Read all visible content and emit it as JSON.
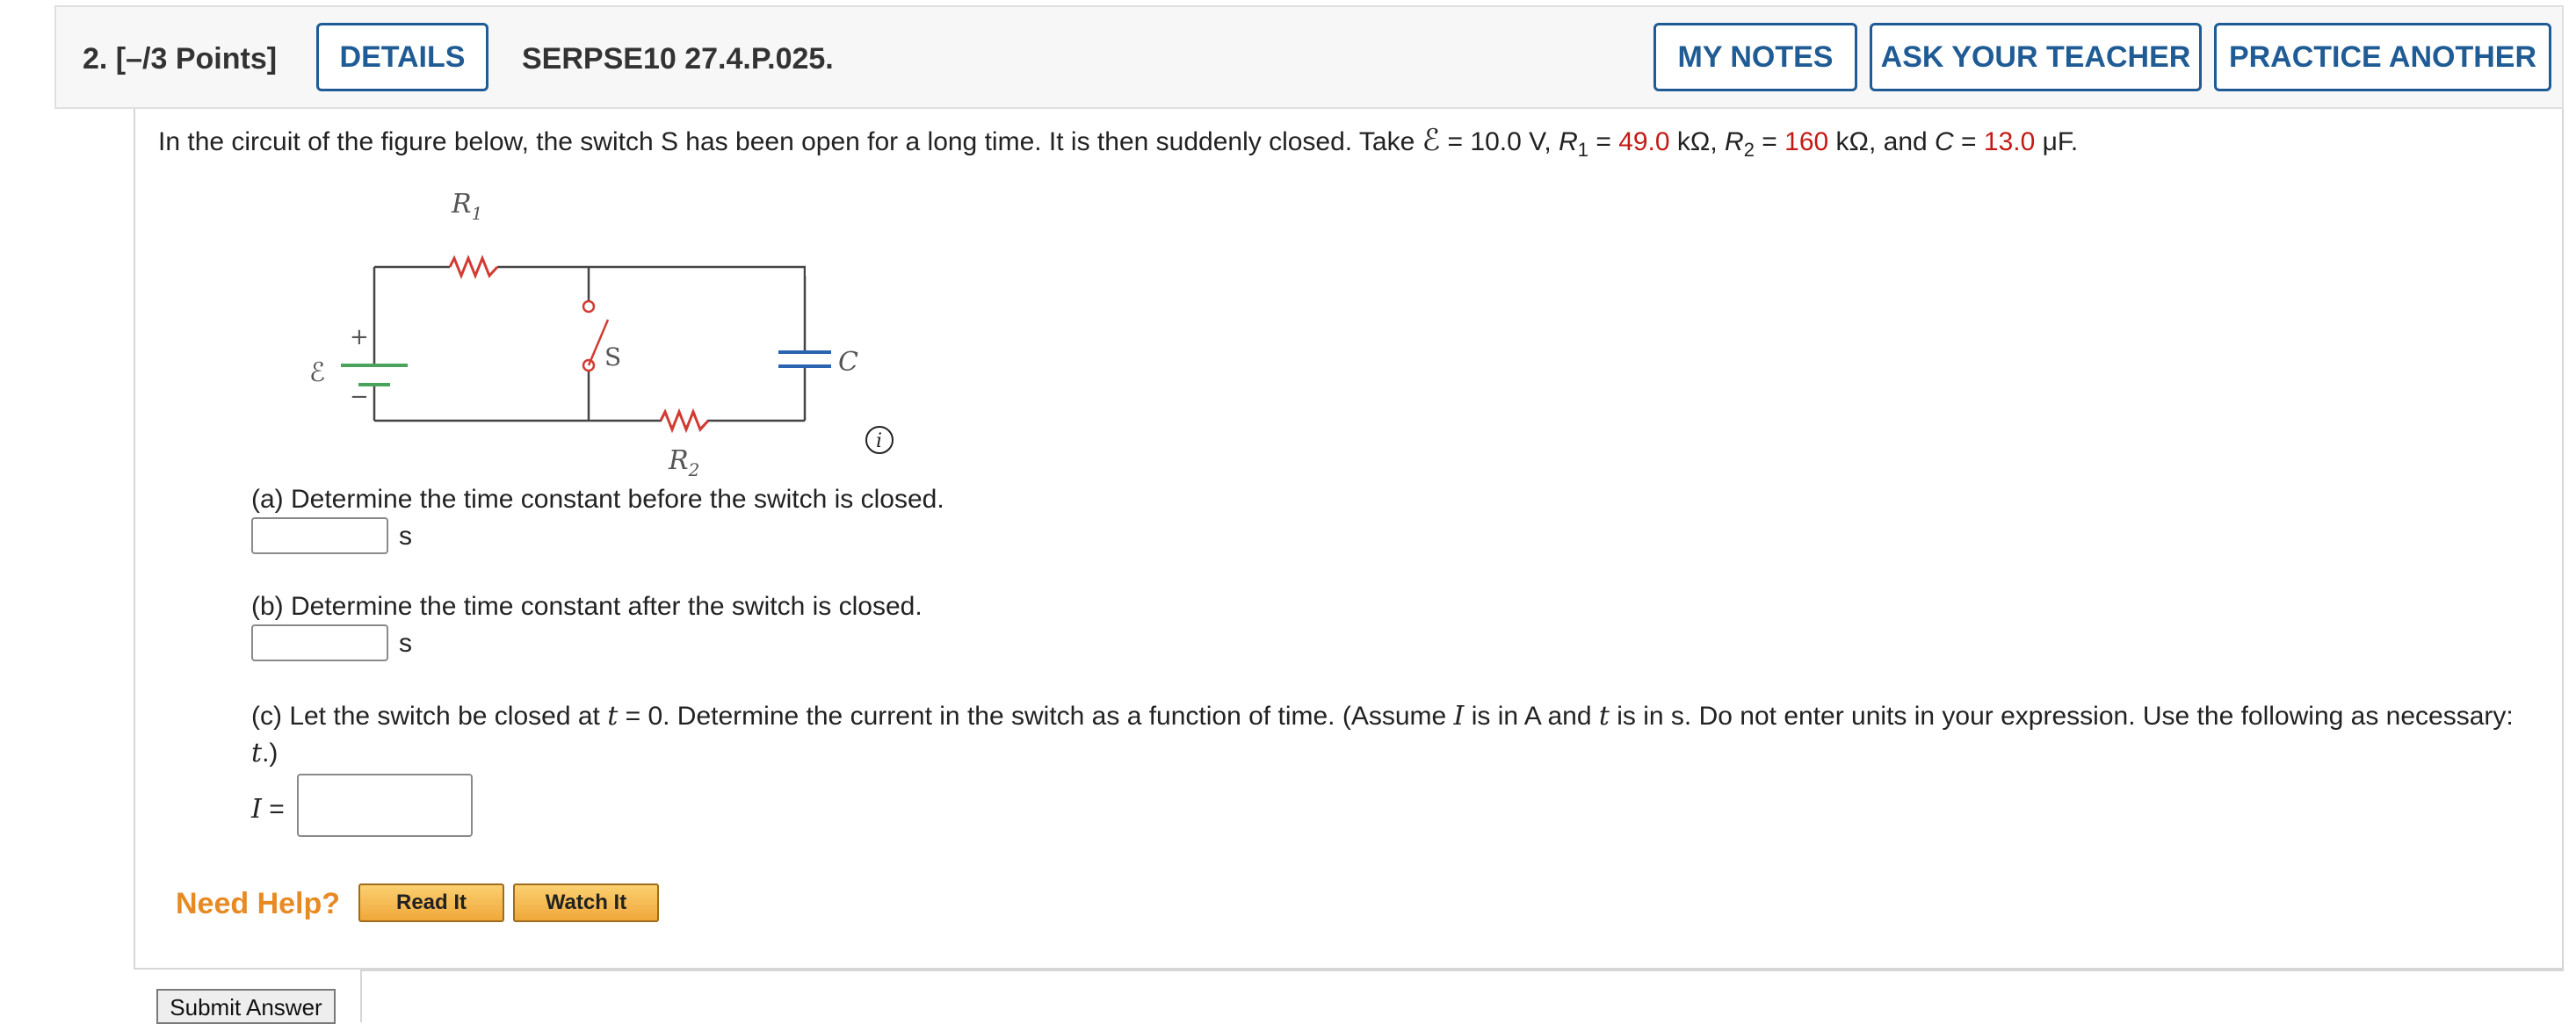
{
  "header": {
    "question_label": "2.  [–/3 Points]",
    "details_label": "DETAILS",
    "question_id": "SERPSE10 27.4.P.025.",
    "my_notes_label": "MY NOTES",
    "ask_teacher_label": "ASK YOUR TEACHER",
    "practice_label": "PRACTICE ANOTHER"
  },
  "problem": {
    "intro": "In the circuit of the figure below, the switch S has been open for a long time. It is then suddenly closed. Take ",
    "emf_symbol": "ℰ",
    "emf_eq": " = 10.0 V, ",
    "r1_sym": "R",
    "r1_sub": "1",
    "r1_eq": " = ",
    "r1_value": "49.0",
    "r1_unit": " kΩ, ",
    "r2_sym": "R",
    "r2_sub": "2",
    "r2_eq": " = ",
    "r2_value": "160",
    "r2_unit": " kΩ, and ",
    "c_sym": "C",
    "c_eq": " = ",
    "c_value": "13.0",
    "c_unit": " μF."
  },
  "figure": {
    "r1_label": "R",
    "r1_sub": "1",
    "r2_label": "R",
    "r2_sub": "2",
    "emf_label": "ℰ",
    "plus": "+",
    "minus": "−",
    "switch_label": "S",
    "cap_label": "C",
    "info_glyph": "i"
  },
  "parts": {
    "a_text": "(a) Determine the time constant before the switch is closed.",
    "a_unit": "s",
    "b_text": "(b) Determine the time constant after the switch is closed.",
    "b_unit": "s",
    "c_text_1": "(c) Let the switch be closed at ",
    "c_t1": "t",
    "c_text_2": " = 0. Determine the current in the switch as a function of time. (Assume ",
    "c_I": "I",
    "c_text_3": " is in A and ",
    "c_t2": "t",
    "c_text_4": " is in s. Do not enter units in your expression. Use the following as necessary:",
    "c_line2_var": "t",
    "c_line2_end": ".)",
    "c_input_var": "I",
    "c_input_eq": " ="
  },
  "help": {
    "need_help": "Need Help?",
    "read_it": "Read It",
    "watch_it": "Watch It"
  },
  "submit_label": "Submit Answer",
  "colors": {
    "accent": "#1f5b94",
    "value_red": "#c41a16",
    "help_orange": "#e88a24"
  }
}
